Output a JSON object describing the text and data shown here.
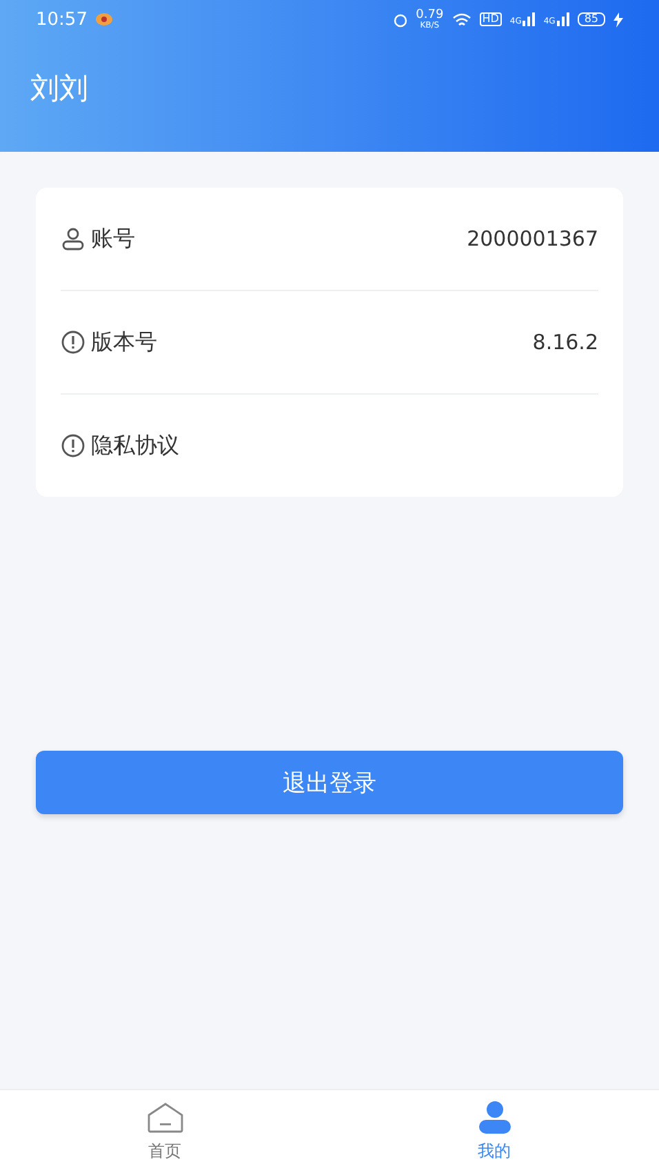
{
  "status_bar": {
    "time": "10:57",
    "net_speed": "0.79",
    "net_unit": "KB/S",
    "hd": "HD",
    "signals": [
      "4G",
      "4G"
    ],
    "battery": "85"
  },
  "header": {
    "title": "刘刘"
  },
  "info_rows": [
    {
      "kind": "user",
      "label": "账号",
      "value": "2000001367"
    },
    {
      "kind": "info",
      "label": "版本号",
      "value": "8.16.2"
    },
    {
      "kind": "info",
      "label": "隐私协议"
    }
  ],
  "logout_button": "退出登录",
  "tabs": [
    {
      "kind": "home",
      "label": "首页",
      "selected": false
    },
    {
      "kind": "me",
      "label": "我的",
      "selected": true
    }
  ]
}
